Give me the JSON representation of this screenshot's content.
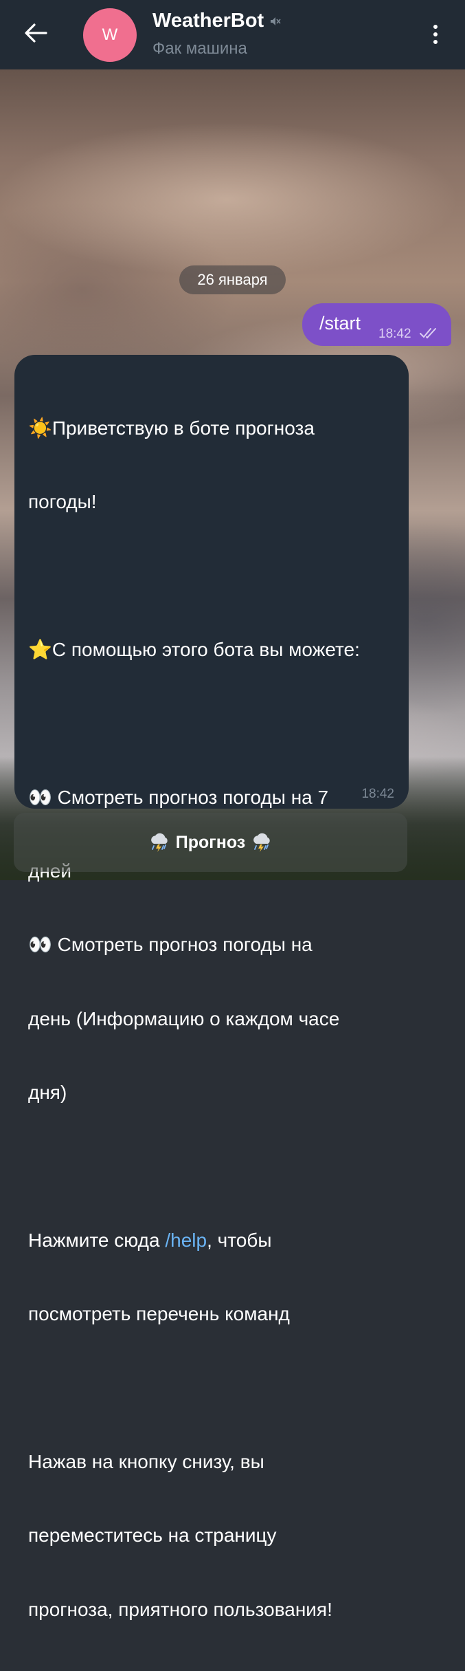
{
  "header": {
    "back_icon": "arrow-left-icon",
    "avatar_letter": "W",
    "title": "WeatherBot",
    "muted_icon": "mute-icon",
    "subtitle": "Фак машина",
    "menu_icon": "more-vertical-icon"
  },
  "chat": {
    "date": "26 января",
    "outgoing": {
      "text": "/start",
      "time": "18:42",
      "status_icon": "double-check-icon"
    },
    "incoming": {
      "lines": [
        "☀️Приветствую в боте прогноза",
        "погоды!",
        "",
        "⭐С помощью этого бота вы можете:",
        "",
        "👀 Смотреть прогноз погоды на 7",
        "дней",
        "👀 Смотреть прогноз погоды на",
        "день (Информацию о каждом часе",
        "дня)",
        "",
        "Нажмите сюда ",
        "посмотреть перечень команд",
        "",
        "Нажав на кнопку снизу, вы",
        "переместитесь на страницу",
        "прогноза, приятного пользования!"
      ],
      "help_prefix": "Нажмите сюда ",
      "help_link": "/help",
      "help_suffix": ", чтобы",
      "time": "18:42"
    }
  },
  "keyboard": {
    "button_label": "Прогноз",
    "button_icon": "cloud-storm-icon"
  },
  "colors": {
    "header_bg": "#222b35",
    "outgoing_bubble": "#7d50c8",
    "incoming_bubble": "#222c37",
    "link": "#6ab3f3",
    "avatar_bg": "#f06f8f"
  }
}
